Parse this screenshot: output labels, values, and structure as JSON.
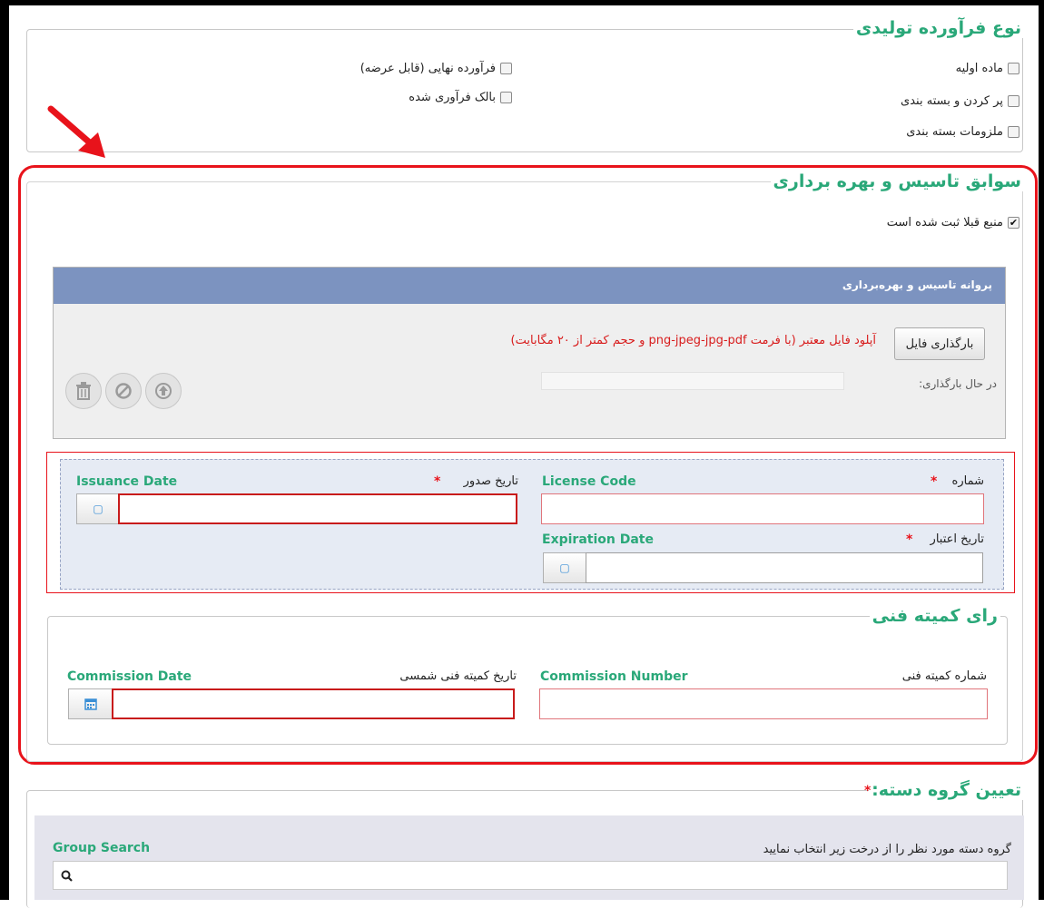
{
  "product_type": {
    "legend": "نوع فرآورده تولیدی",
    "options": [
      {
        "label": "ماده اولیه",
        "checked": false
      },
      {
        "label": "پر کردن و بسته بندی",
        "checked": false
      },
      {
        "label": "ملزومات بسته بندی",
        "checked": false
      },
      {
        "label": "فرآورده نهایی (قابل عرضه)",
        "checked": false
      },
      {
        "label": "بالک فرآوری شده",
        "checked": false
      }
    ]
  },
  "history": {
    "legend": "سوابق تاسیس و بهره برداری",
    "registered_checkbox": {
      "label": "منبع قبلا ثبت شده است",
      "checked": true
    },
    "upload_panel": {
      "title": "پروانه تاسیس و بهره‌برداری",
      "upload_button": "بارگذاری فایل",
      "note": "آپلود فایل معتبر (با فرمت png-jpeg-jpg-pdf و حجم کمتر از ۲۰ مگابایت)",
      "progress_label": "در حال بارگذاری:"
    },
    "license": {
      "number_label": "شماره",
      "license_code": "License Code",
      "issue_label": "تاریخ صدور",
      "issuance_date": "Issuance Date",
      "validity_label": "تاریخ اعتبار",
      "expiration_date": "Expiration Date",
      "required_mark": "*"
    },
    "committee": {
      "legend": "رای کمیته فنی",
      "number_label": "شماره کمیته فنی",
      "commission_number": "Commission Number",
      "date_label": "تاریخ کمیته فنی شمسی",
      "commission_date": "Commission Date"
    }
  },
  "group": {
    "legend": "تعیین گروه دسته:",
    "required_mark": "*",
    "instruction": "گروه دسته مورد نظر را از درخت زیر انتخاب نمایید",
    "search_label": "Group Search",
    "search_placeholder": ""
  },
  "colors": {
    "accent_green": "#2aa879",
    "highlight_red": "#e8131b",
    "panel_header": "#7c93c0"
  }
}
